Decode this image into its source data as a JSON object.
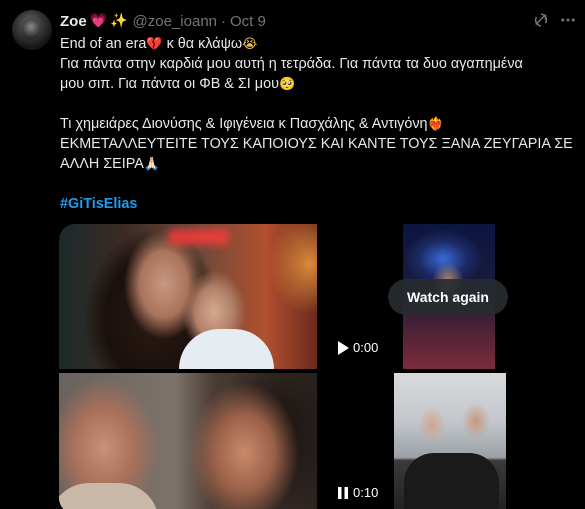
{
  "tweet": {
    "display_name": "Zoe",
    "name_emojis": [
      "💗",
      "✨"
    ],
    "handle": "@zoe_ioann",
    "separator": "·",
    "date": "Oct 9",
    "lines": {
      "l1_text": "End of an era",
      "l1_e1": "💔",
      "l1_text2": " κ θα κλάψω",
      "l1_e2": "😭",
      "l2": "Για πάντα στην καρδιά μου αυτή η τετράδα. Για πάντα τα δυο αγαπημένα",
      "l3_text": "μου σιπ. Για πάντα οι ΦΒ & ΣΙ μου",
      "l3_e": "🥺",
      "l5_text": "Τι χημειάρες Διονύσης & Ιφιγένεια κ Πασχάλης & Αντιγόνη",
      "l5_e": "❤‍🔥",
      "l6": "ΕΚΜΕΤΑΛΛΕΥΤΕΙΤΕ ΤΟΥΣ ΚΑΠΟΙΟΥΣ ΚΑΙ ΚΑΝΤΕ ΤΟΥΣ ΞΑΝΑ ΖΕΥΓΑΡΙΑ ΣΕ",
      "l7_text": "ΑΛΛΗ ΣΕΙΡΑ",
      "l7_e": "🙏🏻",
      "hashtag": "#GiTisElias"
    },
    "media": {
      "watch_again_label": "Watch again",
      "video1_time": "0:00",
      "video2_time": "0:10"
    },
    "icons": {
      "grok": "grok-icon",
      "more": "more-icon",
      "play": "play-icon",
      "pause": "pause-icon"
    },
    "colors": {
      "background": "#000000",
      "text": "#e7e9ea",
      "muted": "#71767b",
      "link": "#1d9bf0"
    }
  }
}
